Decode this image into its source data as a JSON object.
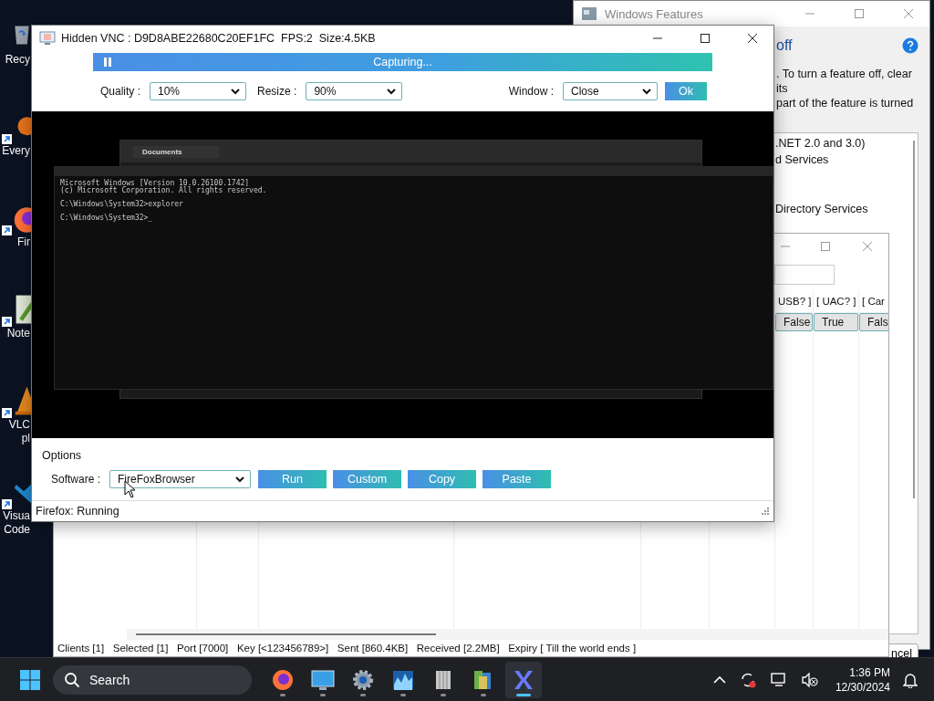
{
  "desktop_icons": [
    {
      "kind": "recycle-bin",
      "shortcut": false,
      "lines": [
        "Recy"
      ]
    },
    {
      "kind": "search-app",
      "shortcut": true,
      "lines": [
        "Every"
      ]
    },
    {
      "kind": "firefox",
      "shortcut": true,
      "lines": [
        "Fir"
      ]
    },
    {
      "kind": "notepad",
      "shortcut": true,
      "lines": [
        "Note"
      ]
    },
    {
      "kind": "vlc",
      "shortcut": true,
      "lines": [
        "VLC",
        "pl"
      ]
    },
    {
      "kind": "vscode",
      "shortcut": true,
      "lines": [
        "Visua",
        "Code"
      ]
    }
  ],
  "features_window": {
    "title": "Windows Features",
    "heading": "off",
    "description": [
      ". To turn a feature off, clear its",
      "part of the feature is turned"
    ],
    "features": [
      ".NET 2.0 and 3.0)",
      "d Services",
      "Directory Services"
    ],
    "cancel": "ncel"
  },
  "host_window": {
    "columns": [
      "USB? ]",
      "[ UAC? ]",
      "[ Car"
    ],
    "rows": [
      {
        "selected": true,
        "cells": [
          "False",
          "True",
          "Fals"
        ]
      }
    ],
    "status_text": "Clients [1]   Selected [1]   Port [7000]   Key [<123456789>]   Sent [860.4KB]   Received [2.2MB]   Expiry [ Till the world ends ]"
  },
  "vnc_window": {
    "title": "Hidden VNC : D9D8ABE22680C20EF1FC  FPS:2  Size:4.5KB",
    "capture_status": "Capturing...",
    "quality": {
      "label": "Quality :",
      "value": "10%"
    },
    "resize": {
      "label": "Resize :",
      "value": "90%"
    },
    "window": {
      "label": "Window :",
      "value": "Close"
    },
    "ok": "Ok",
    "remote_screen": {
      "tab": "Documents",
      "console_blocks": [
        [
          "Microsoft Windows [Version 10.0.26100.1742]",
          "(c) Microsoft Corporation. All rights reserved."
        ],
        [
          "C:\\Windows\\System32>explorer"
        ],
        [
          "C:\\Windows\\System32>_"
        ]
      ]
    },
    "options": {
      "title": "Options",
      "software_label": "Software :",
      "software": "FireFoxBrowser",
      "buttons": [
        "Run",
        "Custom",
        "Copy",
        "Paste"
      ]
    },
    "status": "Firefox: Running"
  },
  "taskbar": {
    "search": "Search",
    "apps": [
      {
        "kind": "firefox",
        "active": false
      },
      {
        "kind": "monitor",
        "active": false
      },
      {
        "kind": "gear",
        "active": false
      },
      {
        "kind": "chart",
        "active": false
      },
      {
        "kind": "archive",
        "active": false
      },
      {
        "kind": "cubes",
        "active": false
      },
      {
        "kind": "x-logo",
        "active": true
      }
    ],
    "time": "1:36 PM",
    "date": "12/30/2024"
  }
}
